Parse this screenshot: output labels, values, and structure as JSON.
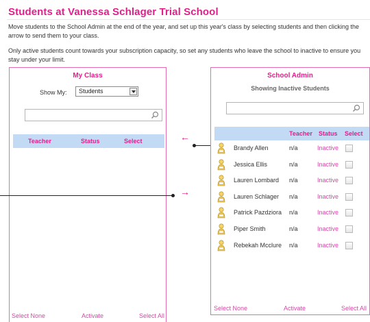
{
  "page": {
    "title": "Students at Vanessa Schlager Trial School",
    "description_1": "Move students to the School Admin at the end of the year, and set up this year's class by selecting students and then clicking the arrow to send them to your class.",
    "description_2": "Only active students count towards your subscription capacity, so set any students who leave the school to inactive to ensure you stay under your limit."
  },
  "my_class": {
    "title": "My Class",
    "show_my_label": "Show My:",
    "show_my_value": "Students",
    "search_placeholder": "",
    "columns": [
      "Teacher",
      "Status",
      "Select"
    ],
    "footer": {
      "select_none": "Select None",
      "activate": "Activate",
      "select_all": "Select All"
    }
  },
  "school_admin": {
    "title": "School Admin",
    "subtitle": "Showing Inactive Students",
    "search_placeholder": "",
    "columns": [
      "Teacher",
      "Status",
      "Select"
    ],
    "students": [
      {
        "name": "Brandy Allen",
        "teacher": "n/a",
        "status": "Inactive"
      },
      {
        "name": "Jessica Ellis",
        "teacher": "n/a",
        "status": "Inactive"
      },
      {
        "name": "Lauren Lombard",
        "teacher": "n/a",
        "status": "Inactive"
      },
      {
        "name": "Lauren Schlager",
        "teacher": "n/a",
        "status": "Inactive"
      },
      {
        "name": "Patrick Pazdziora",
        "teacher": "n/a",
        "status": "Inactive"
      },
      {
        "name": "Piper Smith",
        "teacher": "n/a",
        "status": "Inactive"
      },
      {
        "name": "Rebekah Mcclure",
        "teacher": "n/a",
        "status": "Inactive"
      }
    ],
    "footer": {
      "select_none": "Select None",
      "activate": "Activate",
      "select_all": "Select All"
    }
  },
  "arrows": {
    "to_admin": "←",
    "to_class": "→"
  },
  "icons": {
    "search": "search-icon",
    "student": "student-icon",
    "dropdown": "chevron-down-icon"
  },
  "colors": {
    "accent": "#e0208c",
    "header_bg": "#c2daf4",
    "border": "#e26bb5"
  }
}
